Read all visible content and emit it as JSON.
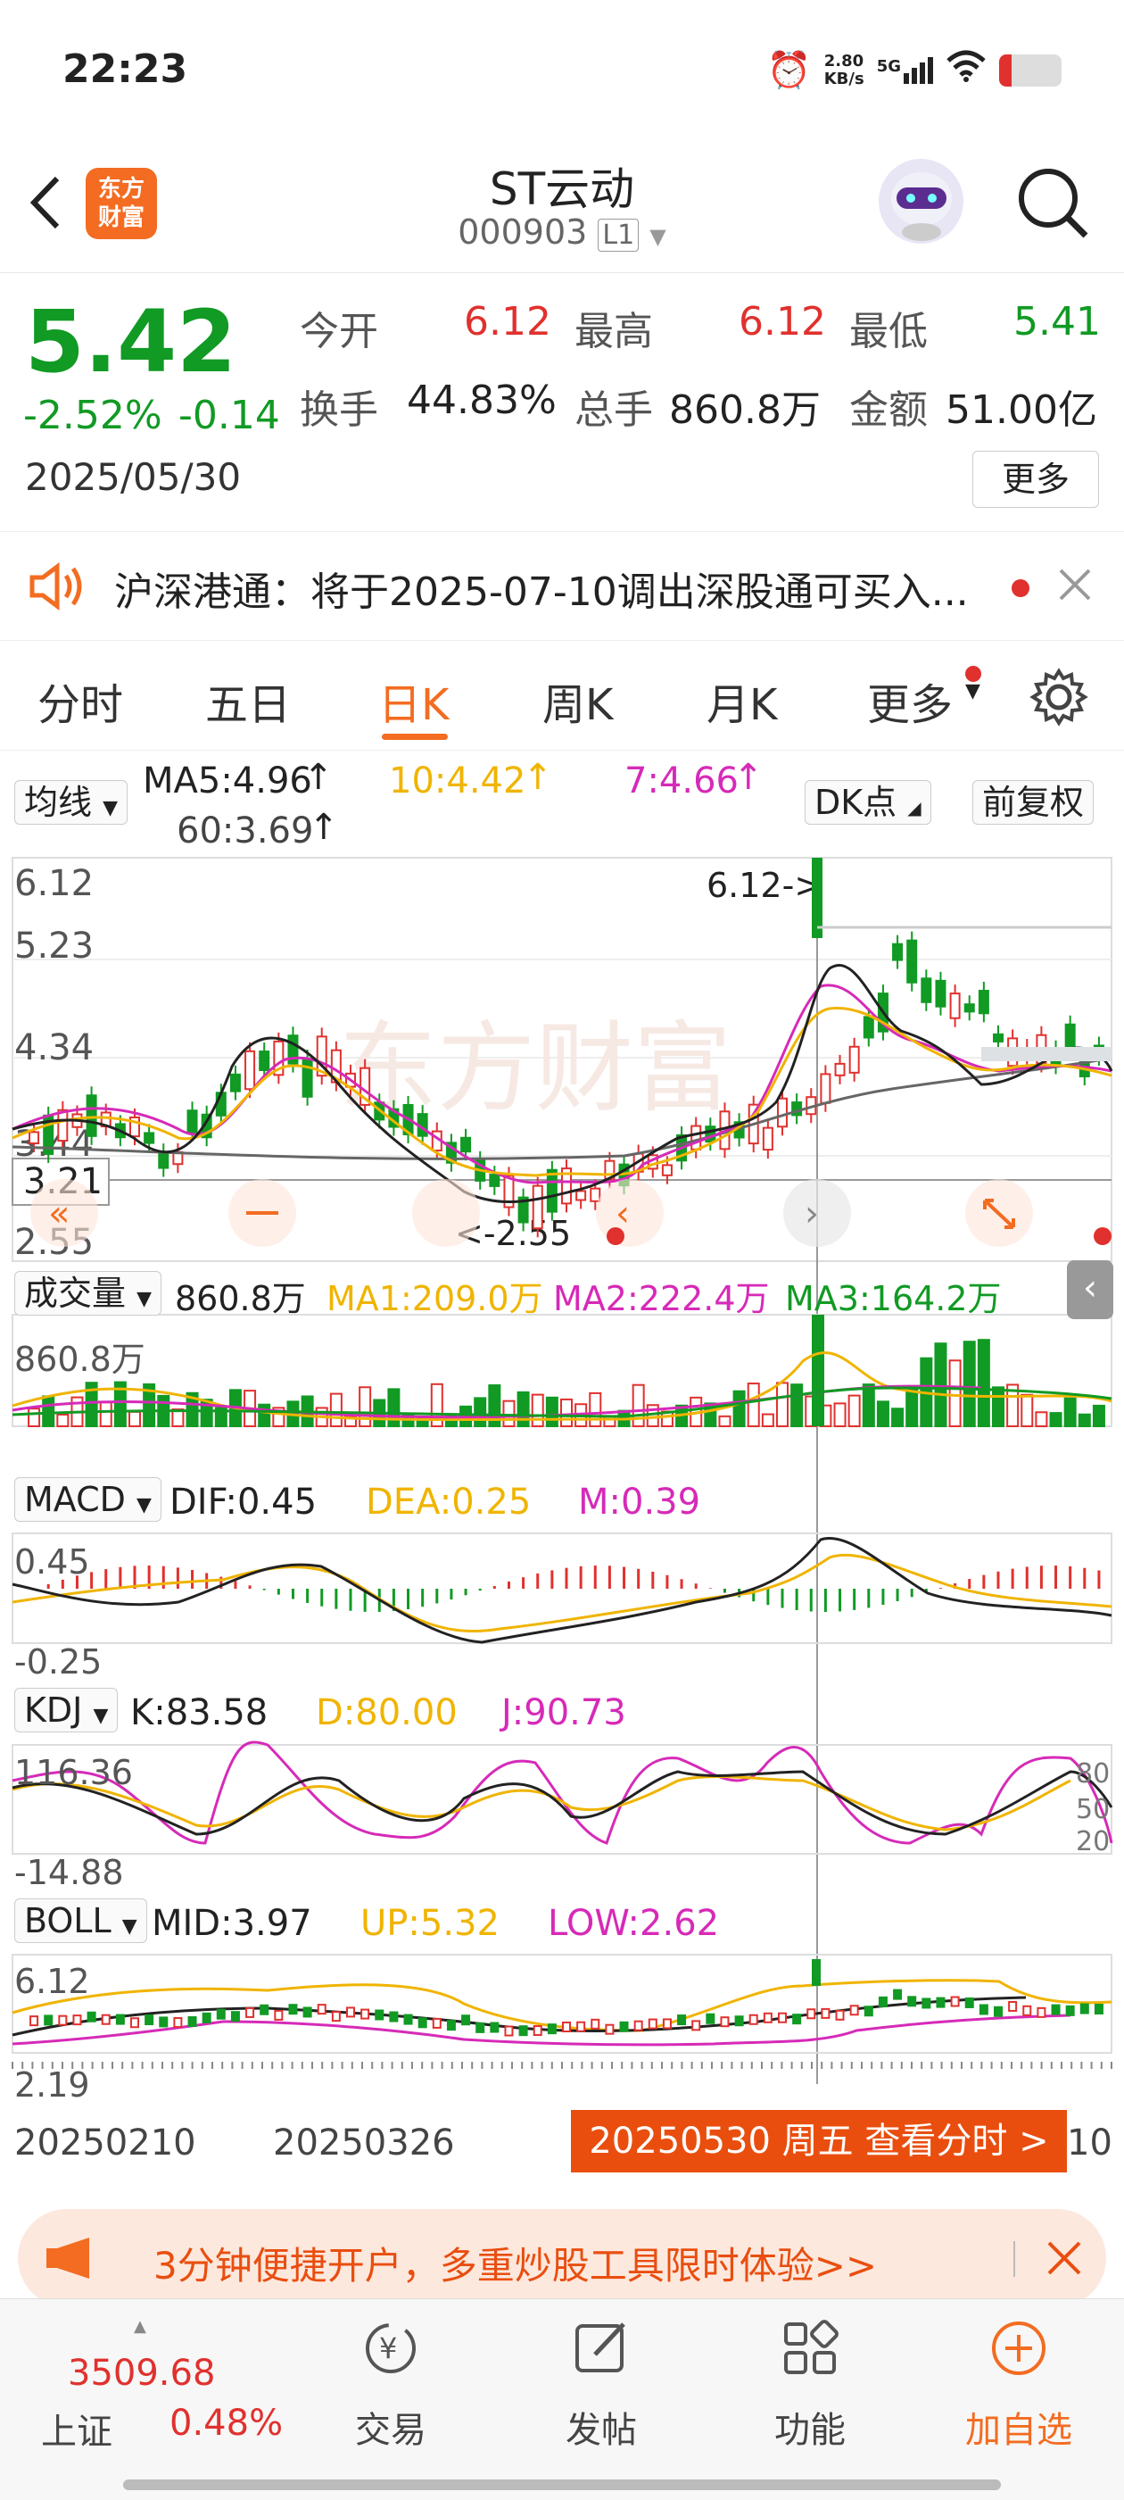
{
  "status": {
    "time": "22:23",
    "speed_top": "2.80",
    "speed_bottom": "KB/s",
    "network": "5G"
  },
  "header": {
    "title": "ST云动",
    "code": "000903",
    "level": "L1",
    "logo_line1": "东方",
    "logo_line2": "财富"
  },
  "quote": {
    "price": "5.42",
    "change_pct": "-2.52%",
    "change": "-0.14",
    "date": "2025/05/30",
    "open_label": "今开",
    "open": "6.12",
    "high_label": "最高",
    "high": "6.12",
    "low_label": "最低",
    "low": "5.41",
    "turnover_label": "换手",
    "turnover": "44.83%",
    "volume_label": "总手",
    "volume": "860.8万",
    "amount_label": "金额",
    "amount": "51.00亿",
    "more_label": "更多"
  },
  "notice": {
    "text": "沪深港通：将于2025-07-10调出深股通可买入..."
  },
  "tabs": [
    "分时",
    "五日",
    "日K",
    "周K",
    "月K",
    "更多"
  ],
  "ma": {
    "select": "均线",
    "ma5": "MA5:4.96",
    "ma10": "10:4.42",
    "ma7": "7:4.66",
    "ma60": "60:3.69",
    "dk": "DK点",
    "fq": "前复权"
  },
  "kline": {
    "y1": "6.12",
    "y2": "5.23",
    "y3": "4.34",
    "y4": "3.44",
    "y5": "2.55",
    "cross_price": "3.21",
    "max_label": "6.12->",
    "min_label": "<-2.55",
    "watermark": "东方财富"
  },
  "vol": {
    "select": "成交量",
    "val": "860.8万",
    "ma1": "MA1:209.0万",
    "ma2": "MA2:222.4万",
    "ma3": "MA3:164.2万",
    "top": "860.8万"
  },
  "macd": {
    "select": "MACD",
    "dif": "DIF:0.45",
    "dea": "DEA:0.25",
    "m": "M:0.39",
    "top": "0.45",
    "bottom": "-0.25"
  },
  "kdj": {
    "select": "KDJ",
    "k": "K:83.58",
    "d": "D:80.00",
    "j": "J:90.73",
    "top": "116.36",
    "bottom": "-14.88",
    "r1": "80",
    "r2": "50",
    "r3": "20"
  },
  "boll": {
    "select": "BOLL",
    "mid": "MID:3.97",
    "up": "UP:5.32",
    "low": "LOW:2.62",
    "top": "6.12",
    "bottom": "2.19"
  },
  "dates": {
    "d1": "20250210",
    "d2": "20250326",
    "d3": "10",
    "popup": "20250530 周五 查看分时 >"
  },
  "promo": {
    "text": "3分钟便捷开户，多重炒股工具限时体验>>"
  },
  "nav": {
    "index_val": "3509.68",
    "index_name": "上证",
    "index_pct": "0.48%",
    "trade": "交易",
    "post": "发帖",
    "func": "功能",
    "add": "加自选"
  },
  "colors": {
    "up": "#e0312e",
    "down": "#119a24",
    "accent": "#f36c21",
    "ma10": "#f0b400",
    "ma20": "#d62ab8"
  }
}
